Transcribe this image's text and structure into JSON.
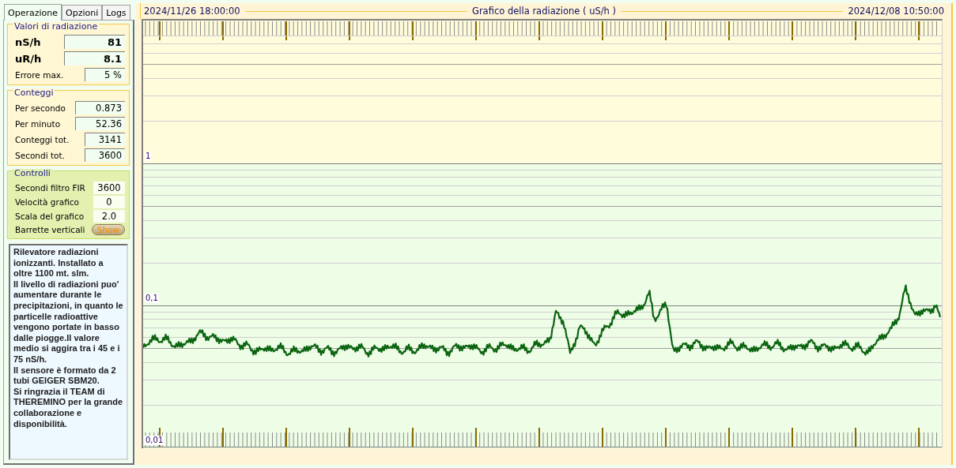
{
  "tabs": [
    {
      "label": "Operazione",
      "selected": true
    },
    {
      "label": "Opzioni",
      "selected": false
    },
    {
      "label": "Logs",
      "selected": false
    }
  ],
  "groups": [
    {
      "title": "Valori di radiazione",
      "kind": "yellow",
      "rows": [
        {
          "label": "nS/h",
          "value": "81",
          "kind": "big"
        },
        {
          "label": "uR/h",
          "value": "8.1",
          "kind": "big"
        },
        {
          "label": "Errore max.",
          "value": "5 %",
          "kind": "small"
        }
      ]
    },
    {
      "title": "Conteggi",
      "kind": "yellow",
      "rows": [
        {
          "label": "Per secondo",
          "value": "0.873",
          "kind": "wide"
        },
        {
          "label": "Per minuto",
          "value": "52.36",
          "kind": "wide"
        },
        {
          "label": "Conteggi tot.",
          "value": "3141",
          "kind": "medium"
        },
        {
          "label": "Secondi tot.",
          "value": "3600",
          "kind": "medium"
        }
      ]
    },
    {
      "title": "Controlli",
      "kind": "green",
      "rows": [
        {
          "label": "Secondi filtro FIR",
          "value": "3600",
          "kind": "control"
        },
        {
          "label": "Velocità grafico",
          "value": "0",
          "kind": "control"
        },
        {
          "label": "Scala del grafico",
          "value": "2.0",
          "kind": "control"
        },
        {
          "label": "Barrette verticali",
          "value": "Show",
          "kind": "button"
        }
      ]
    }
  ],
  "notes": "Rilevatore radiazioni ionizzanti. Installato a oltre 1100 mt. slm.\nIl livello di radiazioni puo' aumentare durante le precipitazioni, in quanto le particelle radioattive vengono portate in basso dalle piogge.Il valore medio si aggira tra i 45 e i 75 nS/h.\nIl sensore è formato da 2 tubi GEIGER SBM20.\nSi ringrazia il TEAM di THEREMINO per la grande collaborazione e disponibilità.",
  "chart": {
    "title": "Grafico della radiazione ( uS/h )",
    "start": "2024/11/26 18:00:00",
    "end": "2024/12/08 10:50:00",
    "y_labels": [
      "1",
      "0,1",
      "0,01"
    ]
  }
}
